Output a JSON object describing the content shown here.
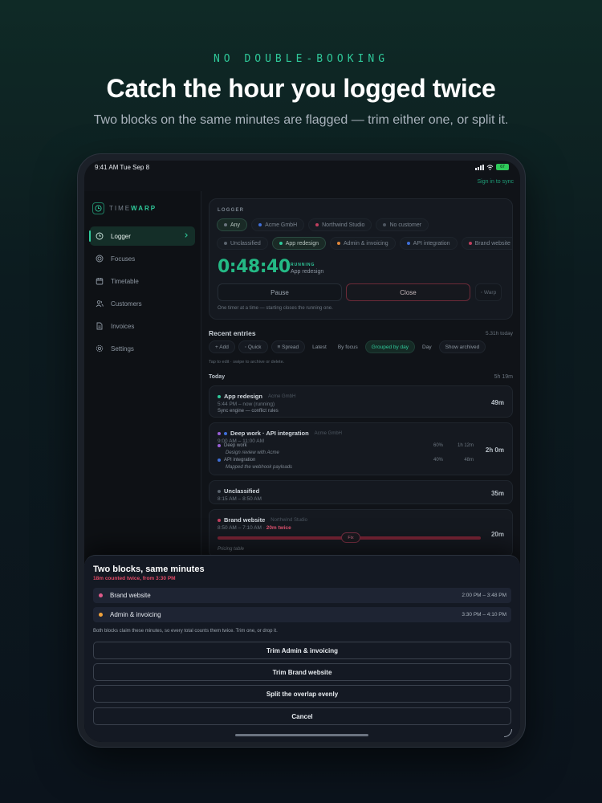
{
  "hero": {
    "eyebrow": "NO DOUBLE-BOOKING",
    "headline": "Catch the hour you logged twice",
    "subline": "Two blocks on the same minutes are flagged — trim either one, or split it."
  },
  "status_bar": {
    "time": "9:41 AM   Tue Sep 8",
    "battery": "67"
  },
  "header": {
    "sign_in": "Sign in to sync"
  },
  "brand": {
    "name_a": "TIME",
    "name_b": "WARP"
  },
  "sidebar": {
    "items": [
      {
        "label": "Logger",
        "icon": "clock-icon"
      },
      {
        "label": "Focuses",
        "icon": "target-icon"
      },
      {
        "label": "Timetable",
        "icon": "calendar-icon"
      },
      {
        "label": "Customers",
        "icon": "users-icon"
      },
      {
        "label": "Invoices",
        "icon": "document-icon"
      },
      {
        "label": "Settings",
        "icon": "gear-icon"
      }
    ]
  },
  "logger": {
    "label": "LOGGER",
    "customer_chips": [
      {
        "label": "Any",
        "color": "#6a747e"
      },
      {
        "label": "Acme GmbH",
        "color": "#3f6fd8"
      },
      {
        "label": "Northwind Studio",
        "color": "#c03f5e"
      },
      {
        "label": "No customer",
        "color": "#4d5660"
      }
    ],
    "focus_chips": [
      {
        "label": "Unclassified",
        "color": "#5a636d"
      },
      {
        "label": "App redesign",
        "color": "#2fc99a"
      },
      {
        "label": "Admin & invoicing",
        "color": "#e0873a"
      },
      {
        "label": "API integration",
        "color": "#3f6fd8"
      },
      {
        "label": "Brand website",
        "color": "#c03f5e"
      }
    ],
    "timer": "0:48:40",
    "state": "RUNNING",
    "task": "App redesign",
    "pause": "Pause",
    "close": "Close",
    "warp": "◦ Warp",
    "note": "One timer at a time — starting closes the running one."
  },
  "recent": {
    "title": "Recent entries",
    "total": "5.31h today",
    "toolbar": [
      "+ Add",
      "◦ Quick",
      "≡ Spread",
      "Latest",
      "By focus",
      "Grouped by day",
      "Day",
      "Show archived"
    ],
    "hint": "Tap to edit · swipe to archive or delete.",
    "day_label": "Today",
    "day_total": "5h 19m",
    "entries": {
      "e1": {
        "title": "App redesign",
        "client": "Acme GmbH",
        "time": "5:44 PM – now  (running)",
        "note": "Sync engine — conflict rules",
        "dur": "49m"
      },
      "e2": {
        "title": "Deep work · API integration",
        "client": "Acme GmbH",
        "time": "9:00 AM – 11:00 AM",
        "dur": "2h 0m",
        "sub1": {
          "name": "Deep work",
          "note": "Design review with Acme",
          "pct": "60%",
          "dur": "1h 12m"
        },
        "sub2": {
          "name": "API integration",
          "note": "Mapped the webhook payloads",
          "pct": "40%",
          "dur": "48m"
        }
      },
      "e3": {
        "title": "Unclassified",
        "time": "8:15 AM – 8:50 AM",
        "dur": "35m"
      },
      "e4": {
        "title": "Brand website",
        "client": "Northwind Studio",
        "time": "8:50 AM – 7:10 AM · ",
        "warn": "20m twice",
        "fix": "Fix",
        "note": "Pricing table",
        "dur": "20m"
      }
    }
  },
  "sheet": {
    "title": "Two blocks, same minutes",
    "subtitle": "18m counted twice, from 3:30 PM",
    "blocks": [
      {
        "name": "Brand website",
        "range": "2:00 PM – 3:48 PM",
        "color": "#e05a8a"
      },
      {
        "name": "Admin & invoicing",
        "range": "3:30 PM – 4:10 PM",
        "color": "#f0a13a"
      }
    ],
    "note": "Both blocks claim these minutes, so every total counts them twice. Trim one, or drop it.",
    "actions": {
      "trim_admin": "Trim Admin & invoicing",
      "trim_brand": "Trim Brand website",
      "split": "Split the overlap evenly",
      "cancel": "Cancel"
    }
  },
  "colors": {
    "accent": "#2fc99a",
    "danger": "#e05270"
  }
}
